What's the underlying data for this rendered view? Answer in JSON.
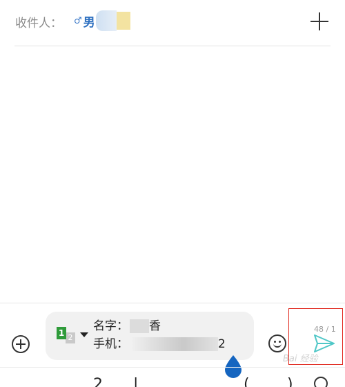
{
  "header": {
    "recipient_label": "收件人：",
    "chip": {
      "gender_symbol": "♂",
      "name": "男"
    },
    "add_button_icon": "plus-icon"
  },
  "compose": {
    "attach_icon": "circle-plus-icon",
    "sim": {
      "primary": "1",
      "secondary": "2"
    },
    "contact_card": {
      "name_label": "名字：",
      "name_suffix": "香",
      "phone_label": "手机：",
      "phone_suffix": "2"
    },
    "emoji_icon": "smiley-icon",
    "char_count": "48 / 1",
    "send_icon": "send-icon",
    "accent_color": "#4fc7c7",
    "highlight_color": "#e0281e"
  },
  "watermark": "Bai 经验",
  "keyboard": {
    "keys": [
      "2",
      "|",
      "(",
      ")"
    ]
  }
}
